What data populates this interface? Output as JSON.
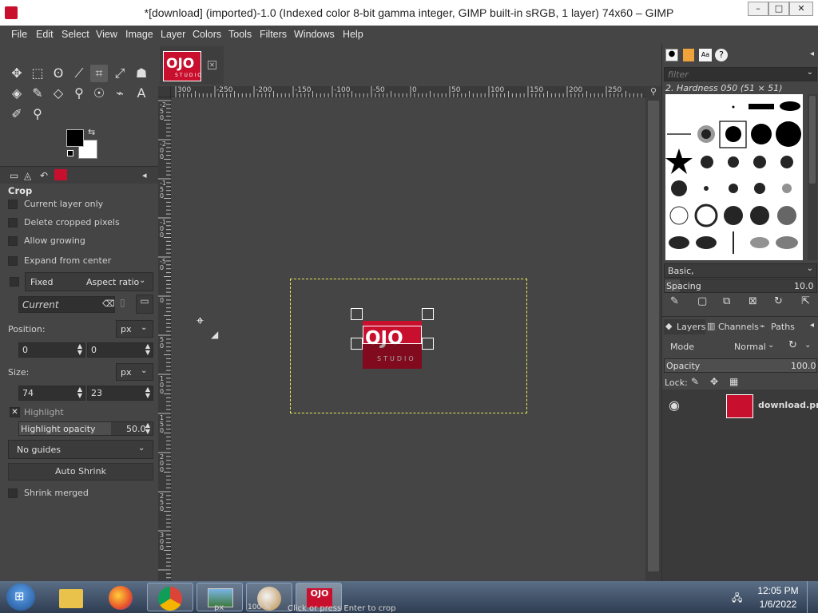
{
  "window": {
    "title": "*[download] (imported)-1.0 (Indexed color 8-bit gamma integer, GIMP built-in sRGB, 1 layer) 74x60 – GIMP",
    "minimize": "–",
    "maximize": "□",
    "close": "✕"
  },
  "menu": [
    "File",
    "Edit",
    "Select",
    "View",
    "Image",
    "Layer",
    "Colors",
    "Tools",
    "Filters",
    "Windows",
    "Help"
  ],
  "tool_options": {
    "title": "Crop",
    "current_layer_only": "Current layer only",
    "delete_cropped": "Delete cropped pixels",
    "allow_growing": "Allow growing",
    "expand_from_center": "Expand from center",
    "fixed_label": "Fixed",
    "fixed_value": "Aspect ratio",
    "current_placeholder": "Current",
    "position_label": "Position:",
    "position_unit": "px",
    "position_x": "0",
    "position_y": "0",
    "size_label": "Size:",
    "size_unit": "px",
    "size_w": "74",
    "size_h": "23",
    "highlight": "Highlight",
    "highlight_opacity_label": "Highlight opacity",
    "highlight_opacity_value": "50.0",
    "guides": "No guides",
    "auto_shrink": "Auto Shrink",
    "shrink_merged": "Shrink merged"
  },
  "ruler": {
    "h_ticks": [
      "300",
      "-250",
      "-200",
      "-150",
      "-100",
      "-50",
      "0",
      "50",
      "100",
      "150",
      "200",
      "250",
      "300"
    ],
    "v_ticks": [
      "-250",
      "-200",
      "-150",
      "-100",
      "-50",
      "0",
      "50",
      "100",
      "150",
      "200",
      "250",
      "300"
    ]
  },
  "image_logo_text": "OJO",
  "image_logo_sub": "STUDIO",
  "brushes": {
    "filter_placeholder": "filter",
    "selected": "2. Hardness 050 (51 × 51)",
    "preset": "Basic,",
    "spacing_label": "Spacing",
    "spacing_value": "10.0"
  },
  "layers_panel": {
    "tabs": [
      "Layers",
      "Channels",
      "Paths"
    ],
    "mode_label": "Mode",
    "mode_value": "Normal",
    "opacity_label": "Opacity",
    "opacity_value": "100.0",
    "lock_label": "Lock:",
    "layer_name": "download.png"
  },
  "statusbar": {
    "unit": "px",
    "zoom": "100 %",
    "message": "Click or press Enter to crop"
  },
  "taskbar": {
    "time": "12:05 PM",
    "date": "1/6/2022"
  },
  "colors": {
    "accent_red": "#c8102e",
    "panel_bg": "#454545",
    "field_bg": "#303030",
    "selection_yellow": "#e8e85a"
  }
}
